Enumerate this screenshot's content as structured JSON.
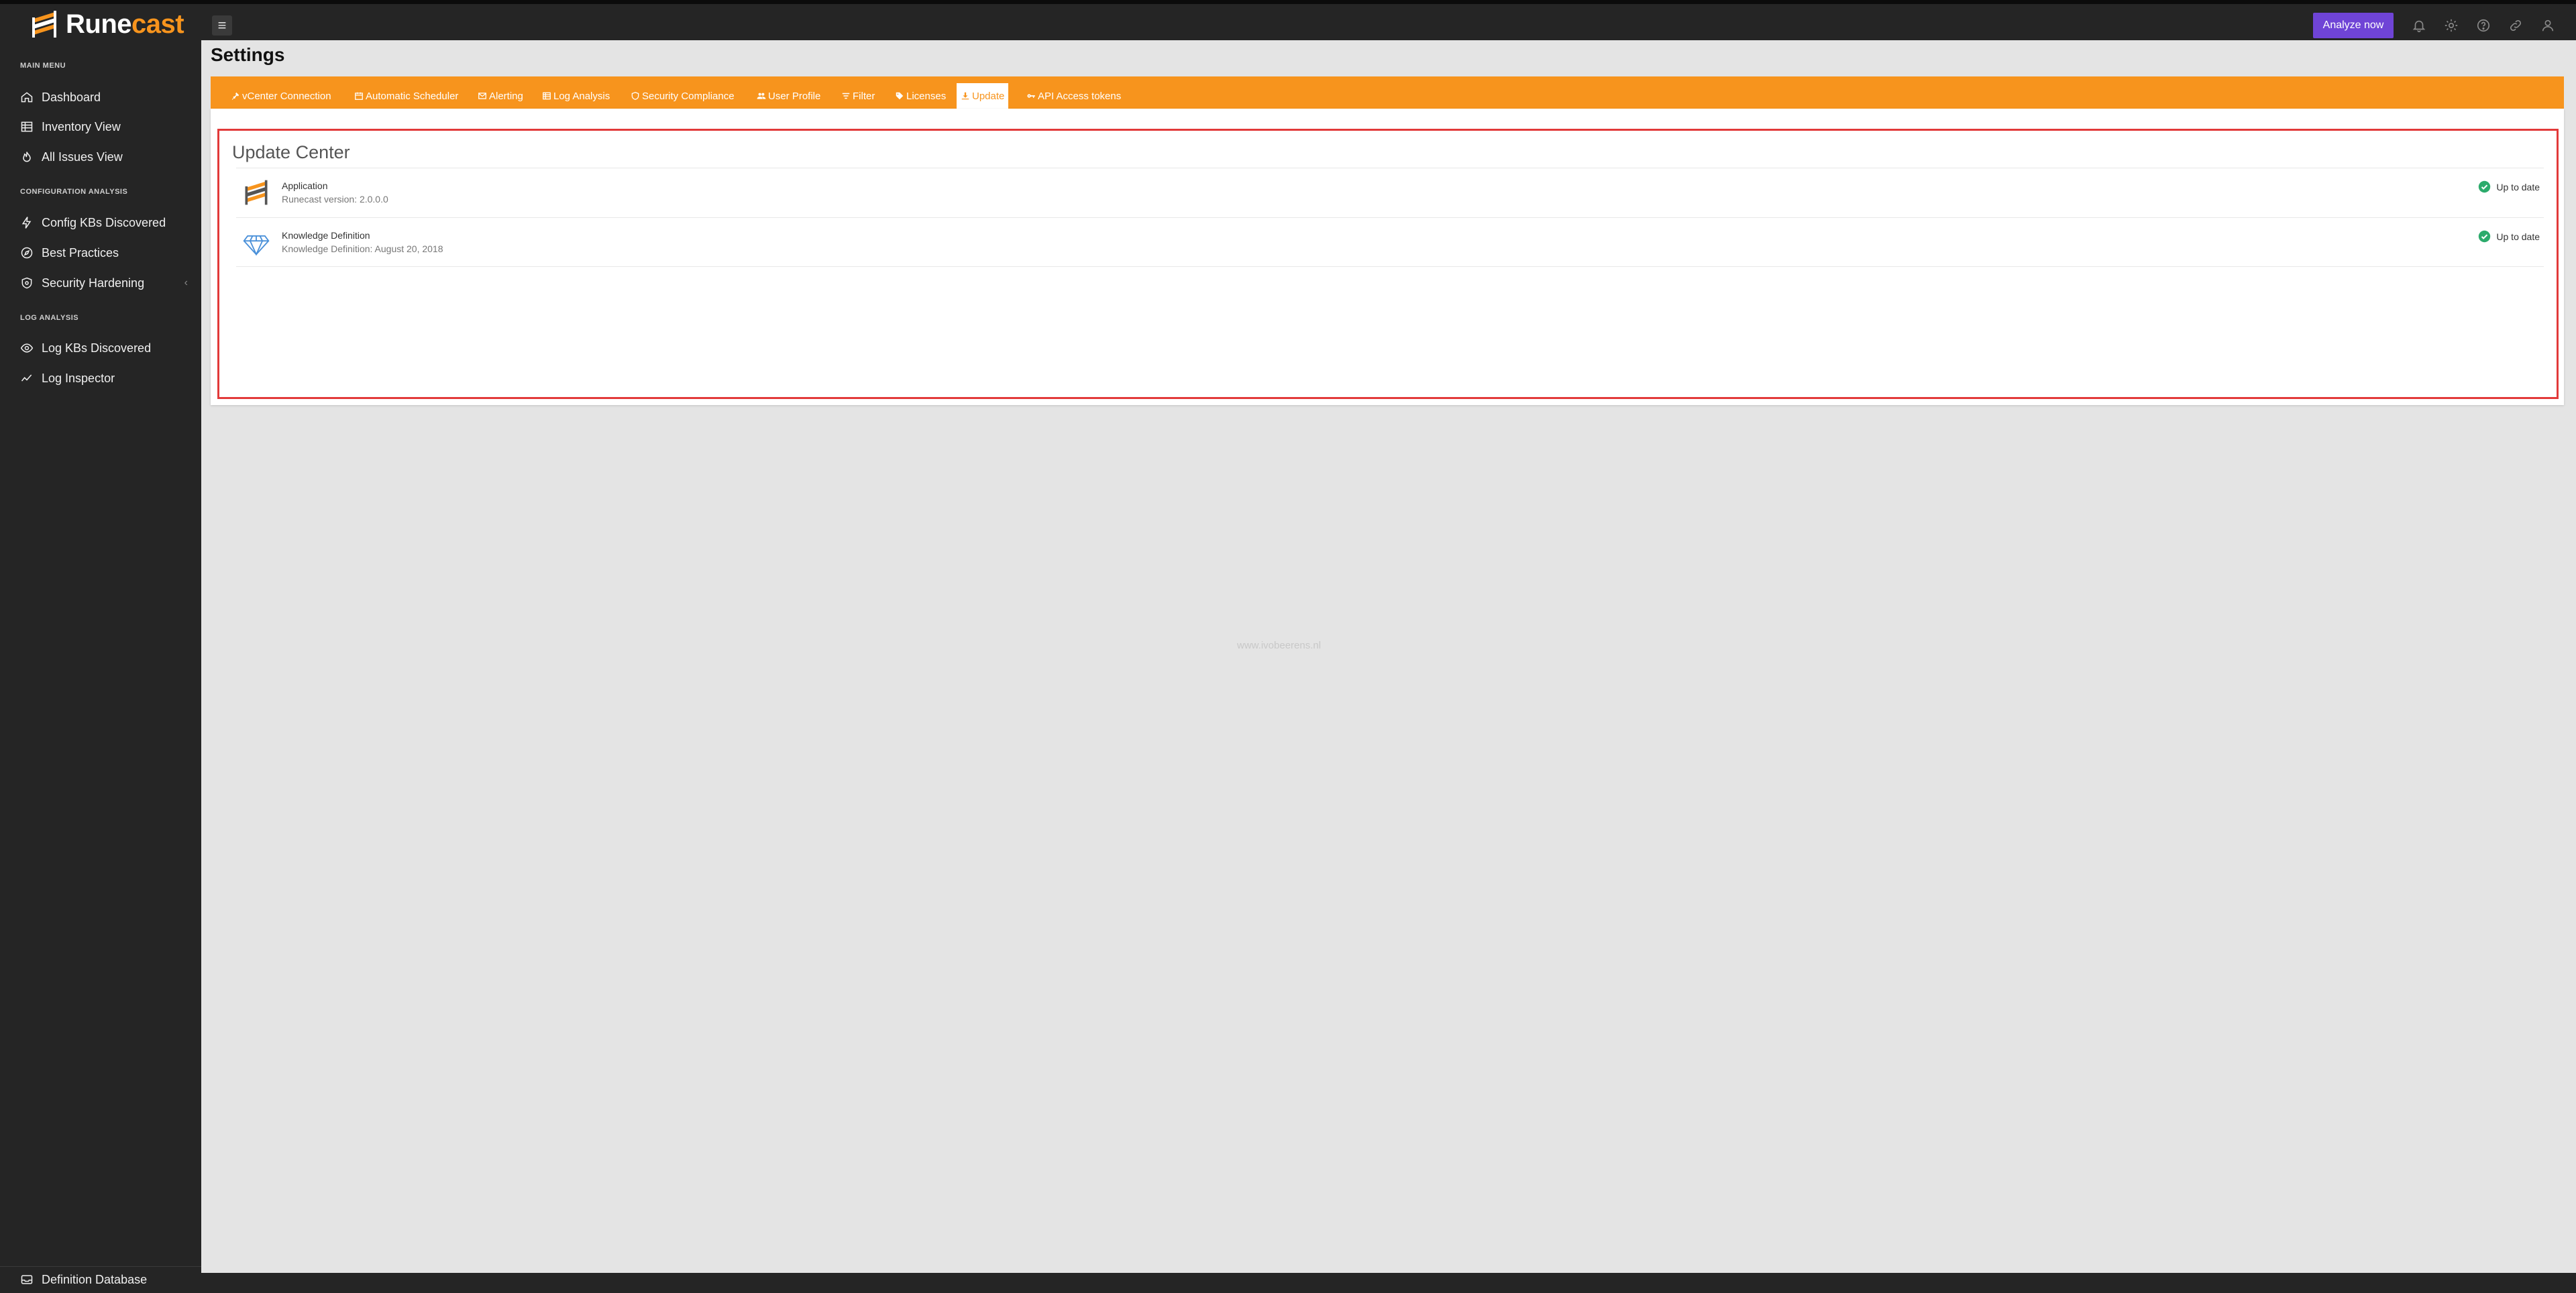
{
  "brand": {
    "name_white": "Rune",
    "name_orange": "cast",
    "accent": "#f7941d",
    "sidebar_bg": "#252525",
    "button_purple": "#6f44d6"
  },
  "topbar": {
    "menu_icon": "hamburger-icon",
    "analyze_label": "Analyze now",
    "icons": [
      "bell-icon",
      "gear-icon",
      "help-icon",
      "link-icon",
      "user-icon"
    ]
  },
  "sidebar": {
    "main_menu_title": "MAIN MENU",
    "main_items": [
      {
        "label": "Dashboard",
        "icon": "home-icon"
      },
      {
        "label": "Inventory View",
        "icon": "table-icon"
      },
      {
        "label": "All Issues View",
        "icon": "fire-icon"
      }
    ],
    "config_title": "CONFIGURATION ANALYSIS",
    "config_items": [
      {
        "label": "Config KBs Discovered",
        "icon": "bolt-icon"
      },
      {
        "label": "Best Practices",
        "icon": "compass-icon"
      },
      {
        "label": "Security Hardening",
        "icon": "shield-icon"
      }
    ],
    "log_title": "LOG ANALYSIS",
    "log_items": [
      {
        "label": "Log KBs Discovered",
        "icon": "eye-icon"
      },
      {
        "label": "Log Inspector",
        "icon": "chart-line-icon"
      }
    ],
    "bottom_item": {
      "label": "Definition Database",
      "icon": "inbox-icon"
    }
  },
  "page": {
    "title": "Settings",
    "tabs": [
      {
        "label": "vCenter Connection",
        "icon": "plug-icon"
      },
      {
        "label": "Automatic Scheduler",
        "icon": "calendar-icon"
      },
      {
        "label": "Alerting",
        "icon": "envelope-icon"
      },
      {
        "label": "Log Analysis",
        "icon": "table-icon"
      },
      {
        "label": "Security Compliance",
        "icon": "shield-icon"
      },
      {
        "label": "User Profile",
        "icon": "users-icon"
      },
      {
        "label": "Filter",
        "icon": "filter-icon"
      },
      {
        "label": "Licenses",
        "icon": "tag-icon"
      },
      {
        "label": "Update",
        "icon": "download-icon",
        "active": true
      },
      {
        "label": "API Access tokens",
        "icon": "key-icon"
      }
    ]
  },
  "update_center": {
    "title": "Update Center",
    "items": [
      {
        "name": "Application",
        "detail": "Runecast version: 2.0.0.0",
        "status": "Up to date",
        "icon": "runecast-logo-icon"
      },
      {
        "name": "Knowledge Definition",
        "detail": "Knowledge Definition: August 20, 2018",
        "status": "Up to date",
        "icon": "diamond-icon"
      }
    ]
  },
  "watermark": "www.ivobeerens.nl"
}
